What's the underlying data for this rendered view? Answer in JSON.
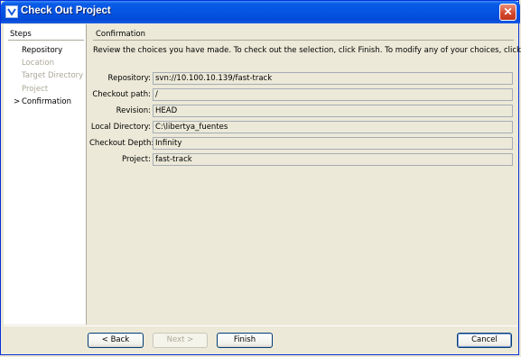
{
  "window": {
    "title": "Check Out Project",
    "close_glyph": "✕"
  },
  "steps": {
    "title": "Steps",
    "items": [
      {
        "label": "Repository",
        "state": "done"
      },
      {
        "label": "Location",
        "state": "disabled"
      },
      {
        "label": "Target Directory",
        "state": "disabled"
      },
      {
        "label": "Project",
        "state": "disabled"
      },
      {
        "label": "Confirmation",
        "state": "current"
      }
    ],
    "current_marker": ">"
  },
  "confirmation": {
    "title": "Confirmation",
    "description": "Review the choices you have made. To check out the selection, click Finish. To modify any of your choices, click Back.",
    "fields": [
      {
        "label": "Repository:",
        "value": "svn://10.100.10.139/fast-track"
      },
      {
        "label": "Checkout path:",
        "value": "/"
      },
      {
        "label": "Revision:",
        "value": "HEAD"
      },
      {
        "label": "Local Directory:",
        "value": "C:\\libertya_fuentes"
      },
      {
        "label": "Checkout Depth:",
        "value": "Infinity"
      },
      {
        "label": "Project:",
        "value": "fast-track"
      }
    ]
  },
  "buttons": {
    "back": "< Back",
    "next": "Next >",
    "finish": "Finish",
    "cancel": "Cancel"
  }
}
